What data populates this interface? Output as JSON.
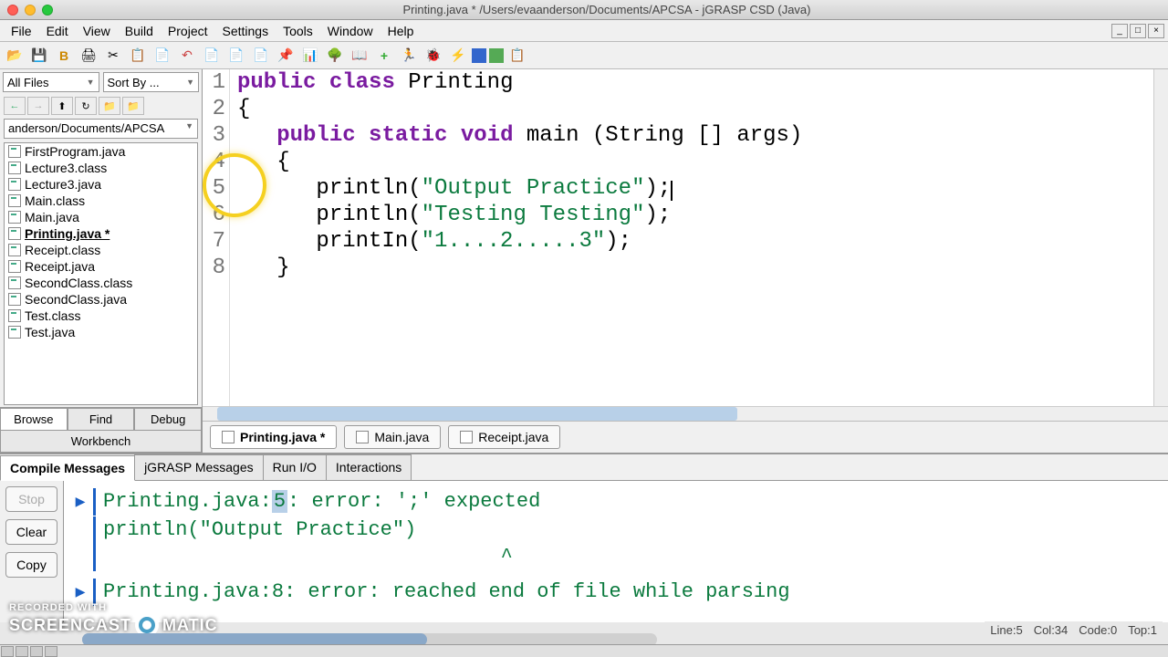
{
  "title": "Printing.java * /Users/evaanderson/Documents/APCSA - jGRASP CSD (Java)",
  "menu": [
    "File",
    "Edit",
    "View",
    "Build",
    "Project",
    "Settings",
    "Tools",
    "Window",
    "Help"
  ],
  "sidebar": {
    "filter": "All Files",
    "sort": "Sort By ...",
    "path": "anderson/Documents/APCSA",
    "files": [
      {
        "name": "FirstProgram.java",
        "active": false
      },
      {
        "name": "Lecture3.class",
        "active": false
      },
      {
        "name": "Lecture3.java",
        "active": false
      },
      {
        "name": "Main.class",
        "active": false
      },
      {
        "name": "Main.java",
        "active": false
      },
      {
        "name": "Printing.java *",
        "active": true
      },
      {
        "name": "Receipt.class",
        "active": false
      },
      {
        "name": "Receipt.java",
        "active": false
      },
      {
        "name": "SecondClass.class",
        "active": false
      },
      {
        "name": "SecondClass.java",
        "active": false
      },
      {
        "name": "Test.class",
        "active": false
      },
      {
        "name": "Test.java",
        "active": false
      }
    ],
    "tabs": [
      "Browse",
      "Find",
      "Debug"
    ],
    "workbench": "Workbench"
  },
  "code": {
    "lines": [
      "1",
      "2",
      "3",
      "4",
      "5",
      "6",
      "7",
      "8"
    ],
    "l1_kw1": "public",
    "l1_kw2": "class",
    "l1_id": "Printing",
    "l2": "{",
    "l3_kw1": "public",
    "l3_kw2": "static",
    "l3_kw3": "void",
    "l3_rest": "main (String [] args)",
    "l4": "   {",
    "l5_a": "      println(",
    "l5_s": "\"Output Practice\"",
    "l5_b": ");",
    "l6_a": "      println(",
    "l6_s": "\"Testing Testing\"",
    "l6_b": ");",
    "l7_a": "      printIn(",
    "l7_s": "\"1....2.....3\"",
    "l7_b": ");",
    "l8": "   }"
  },
  "editor_tabs": [
    {
      "label": "Printing.java *",
      "active": true
    },
    {
      "label": "Main.java",
      "active": false
    },
    {
      "label": "Receipt.java",
      "active": false
    }
  ],
  "console": {
    "tabs": [
      "Compile Messages",
      "jGRASP Messages",
      "Run I/O",
      "Interactions"
    ],
    "buttons": {
      "stop": "Stop",
      "clear": "Clear",
      "copy": "Copy"
    },
    "err1_pre": "Printing.java:",
    "err1_hl": "5",
    "err1_post": ": error: ';' expected",
    "err1_code": "       println(\"Output Practice\")",
    "err1_caret": "                                 ^",
    "err2": "Printing.java:8: error: reached end of file while parsing"
  },
  "status": {
    "line": "Line:5",
    "col": "Col:34",
    "code": "Code:0",
    "top": "Top:1"
  },
  "watermark": {
    "small": "RECORDED WITH",
    "big1": "SCREENCAST",
    "big2": "MATIC"
  }
}
